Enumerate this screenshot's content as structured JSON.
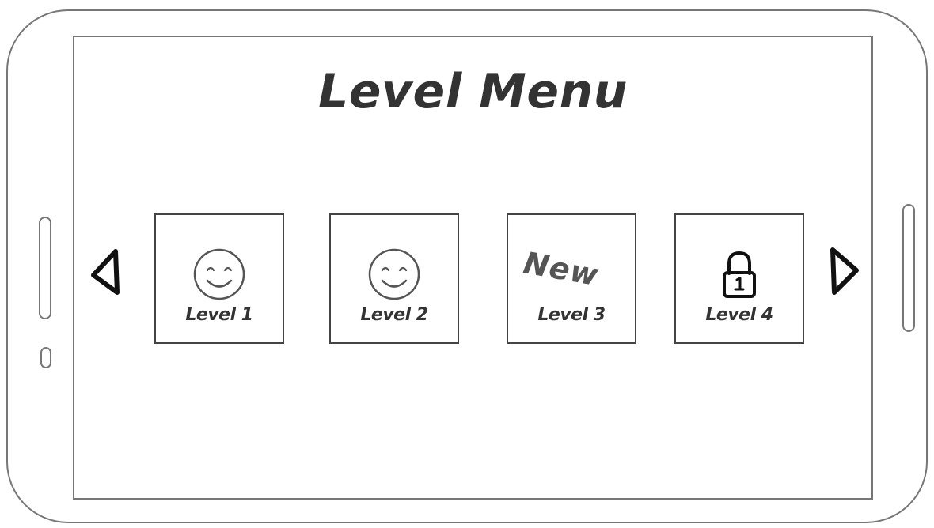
{
  "title": "Level Menu",
  "navigation": {
    "prev_icon": "triangle-left-icon",
    "next_icon": "triangle-right-icon"
  },
  "levels": [
    {
      "label": "Level 1",
      "icon": "smiley-face-icon",
      "status": "completed"
    },
    {
      "label": "Level 2",
      "icon": "smiley-face-icon",
      "status": "completed"
    },
    {
      "label": "Level 3",
      "badge": "New",
      "status": "new"
    },
    {
      "label": "Level 4",
      "icon": "padlock-icon",
      "status": "locked"
    }
  ],
  "colors": {
    "ink": "#333333",
    "frame": "#777777",
    "background": "#ffffff"
  }
}
